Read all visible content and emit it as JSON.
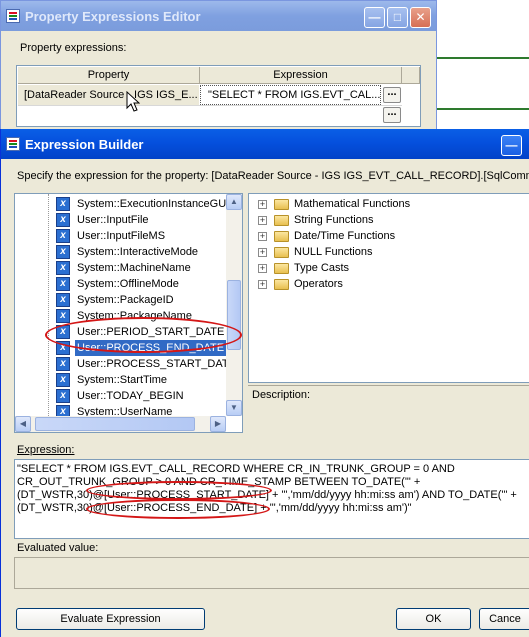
{
  "editor": {
    "title": "Property Expressions Editor",
    "section_label": "Property expressions:",
    "columns": {
      "property": "Property",
      "expression": "Expression"
    },
    "rows": [
      {
        "property": "[DataReader Source - IGS IGS_E...",
        "expression": "\"SELECT * FROM IGS.EVT_CAL...",
        "button": "..."
      }
    ],
    "empty_row_button": "..."
  },
  "builder": {
    "title": "Expression Builder",
    "instruction": "Specify the expression for the property: [DataReader Source - IGS IGS_EVT_CALL_RECORD].[SqlCommand",
    "variables": [
      "System::ExecutionInstanceGUI",
      "User::InputFile",
      "User::InputFileMS",
      "System::InteractiveMode",
      "System::MachineName",
      "System::OfflineMode",
      "System::PackageID",
      "System::PackageName",
      "User::PERIOD_START_DATE",
      "User::PROCESS_END_DATE",
      "User::PROCESS_START_DAT",
      "System::StartTime",
      "User::TODAY_BEGIN",
      "System::UserName"
    ],
    "selected_variable": "User::PROCESS_END_DATE",
    "functions": [
      "Mathematical Functions",
      "String Functions",
      "Date/Time Functions",
      "NULL Functions",
      "Type Casts",
      "Operators"
    ],
    "description_label": "Description:",
    "expression_label": "Expression:",
    "expression_lines": [
      "\"SELECT * FROM IGS.EVT_CALL_RECORD WHERE CR_IN_TRUNK_GROUP = 0 AND",
      "CR_OUT_TRUNK_GROUP > 0 AND CR_TIME_STAMP BETWEEN TO_DATE('\" +",
      "(DT_WSTR,30)@[User::PROCESS_START_DATE] + \"','mm/dd/yyyy hh:mi:ss am') AND TO_DATE('\" +",
      "(DT_WSTR,30)@[User::PROCESS_END_DATE] + \"','mm/dd/yyyy hh:mi:ss am')\""
    ],
    "evaluated_label": "Evaluated value:",
    "evaluated_value": "",
    "buttons": {
      "evaluate": "Evaluate Expression",
      "ok": "OK",
      "cancel": "Cance"
    }
  },
  "colors": {
    "title_active": "#0550dd",
    "title_inactive": "#7fa0e0",
    "selection": "#316ac5",
    "annotation": "#d41616"
  }
}
